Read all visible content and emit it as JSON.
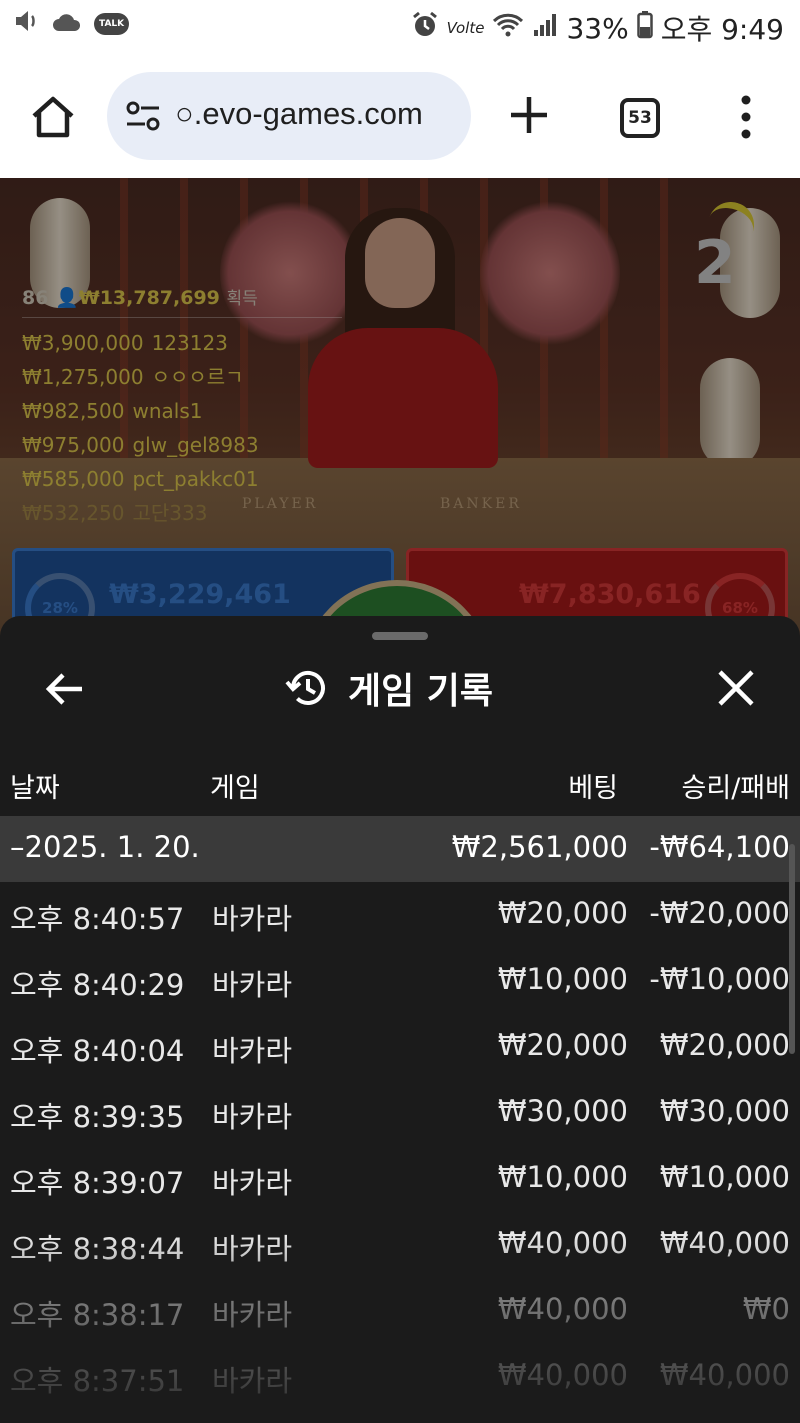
{
  "status_bar": {
    "kakao_badge": "TALK",
    "network": "Volte",
    "battery": "33%",
    "time": "오후 9:49"
  },
  "browser": {
    "url": "○.evo-games.com",
    "tab_count": "53"
  },
  "live_video": {
    "round_number": "2",
    "table_labels": [
      "PLAYER",
      "BANKER"
    ],
    "winners_summary": {
      "count": "86",
      "amount": "₩13,787,699",
      "label": "획득"
    },
    "winners": [
      {
        "amount": "₩3,900,000",
        "name": "123123"
      },
      {
        "amount": "₩1,275,000",
        "name": "ㅇㅇㅇ르ㄱ"
      },
      {
        "amount": "₩982,500",
        "name": "wnals1"
      },
      {
        "amount": "₩975,000",
        "name": "glw_gel8983"
      },
      {
        "amount": "₩585,000",
        "name": "pct_pakkc01"
      },
      {
        "amount": "₩532,250",
        "name": "고단333"
      }
    ],
    "player_bet": {
      "percent": "28%",
      "amount": "₩3,229,461",
      "color": "#3a78c9"
    },
    "banker_bet": {
      "percent": "68%",
      "amount": "₩7,830,616",
      "color": "#d23838"
    }
  },
  "history_sheet": {
    "title": "게임 기록",
    "columns": {
      "date": "날짜",
      "game": "게임",
      "bet": "베팅",
      "win_loss": "승리/패배"
    },
    "day_summary": {
      "date": "–2025. 1. 20.",
      "bet": "₩2,561,000",
      "win_loss": "-₩64,100"
    },
    "rows": [
      {
        "time": "오후 8:40:57",
        "game": "바카라",
        "bet": "₩20,000",
        "win_loss": "-₩20,000"
      },
      {
        "time": "오후 8:40:29",
        "game": "바카라",
        "bet": "₩10,000",
        "win_loss": "-₩10,000"
      },
      {
        "time": "오후 8:40:04",
        "game": "바카라",
        "bet": "₩20,000",
        "win_loss": "₩20,000"
      },
      {
        "time": "오후 8:39:35",
        "game": "바카라",
        "bet": "₩30,000",
        "win_loss": "₩30,000"
      },
      {
        "time": "오후 8:39:07",
        "game": "바카라",
        "bet": "₩10,000",
        "win_loss": "₩10,000"
      },
      {
        "time": "오후 8:38:44",
        "game": "바카라",
        "bet": "₩40,000",
        "win_loss": "₩40,000"
      },
      {
        "time": "오후 8:38:17",
        "game": "바카라",
        "bet": "₩40,000",
        "win_loss": "₩0"
      },
      {
        "time": "오후 8:37:51",
        "game": "바카라",
        "bet": "₩40,000",
        "win_loss": "₩40,000"
      }
    ]
  }
}
